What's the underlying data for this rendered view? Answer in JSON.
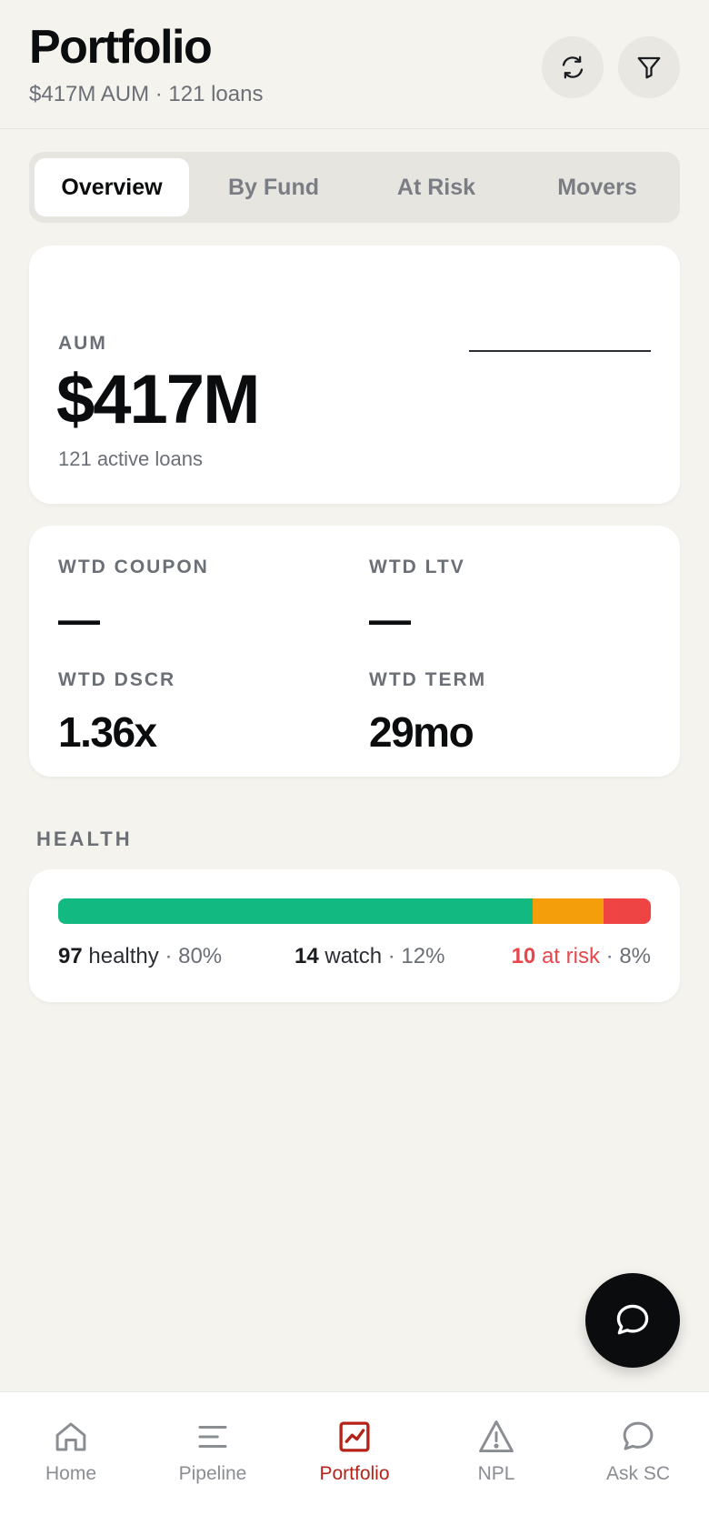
{
  "header": {
    "title": "Portfolio",
    "subtitle": "$417M AUM · 121 loans",
    "refresh_icon": "refresh-icon",
    "filter_icon": "filter-icon"
  },
  "tabs": [
    {
      "label": "Overview",
      "active": true
    },
    {
      "label": "By Fund",
      "active": false
    },
    {
      "label": "At Risk",
      "active": false
    },
    {
      "label": "Movers",
      "active": false
    }
  ],
  "aum": {
    "label": "AUM",
    "value": "$417M",
    "sub": "121 active loans"
  },
  "metrics": [
    {
      "label": "WTD COUPON",
      "value": "—"
    },
    {
      "label": "WTD LTV",
      "value": "—"
    },
    {
      "label": "WTD DSCR",
      "value": "1.36x"
    },
    {
      "label": "WTD TERM",
      "value": "29mo"
    }
  ],
  "health": {
    "section_label": "HEALTH",
    "segments": [
      {
        "count": "97",
        "word": "healthy",
        "pct": "80%",
        "fraction": 0.8,
        "color": "#12b981"
      },
      {
        "count": "14",
        "word": "watch",
        "pct": "12%",
        "fraction": 0.12,
        "color": "#f59e0b"
      },
      {
        "count": "10",
        "word": "at risk",
        "pct": "8%",
        "fraction": 0.08,
        "color": "#ef4444"
      }
    ]
  },
  "fab": {
    "icon": "chat-bubble-icon"
  },
  "nav": [
    {
      "label": "Home",
      "icon": "home-icon",
      "active": false
    },
    {
      "label": "Pipeline",
      "icon": "lines-icon",
      "active": false
    },
    {
      "label": "Portfolio",
      "icon": "chart-icon",
      "active": true
    },
    {
      "label": "NPL",
      "icon": "warning-icon",
      "active": false
    },
    {
      "label": "Ask SC",
      "icon": "chat-icon",
      "active": false
    }
  ],
  "colors": {
    "background": "#f4f3ee",
    "accent_active": "#b42318",
    "healthy": "#12b981",
    "watch": "#f59e0b",
    "risk": "#ef4444"
  }
}
